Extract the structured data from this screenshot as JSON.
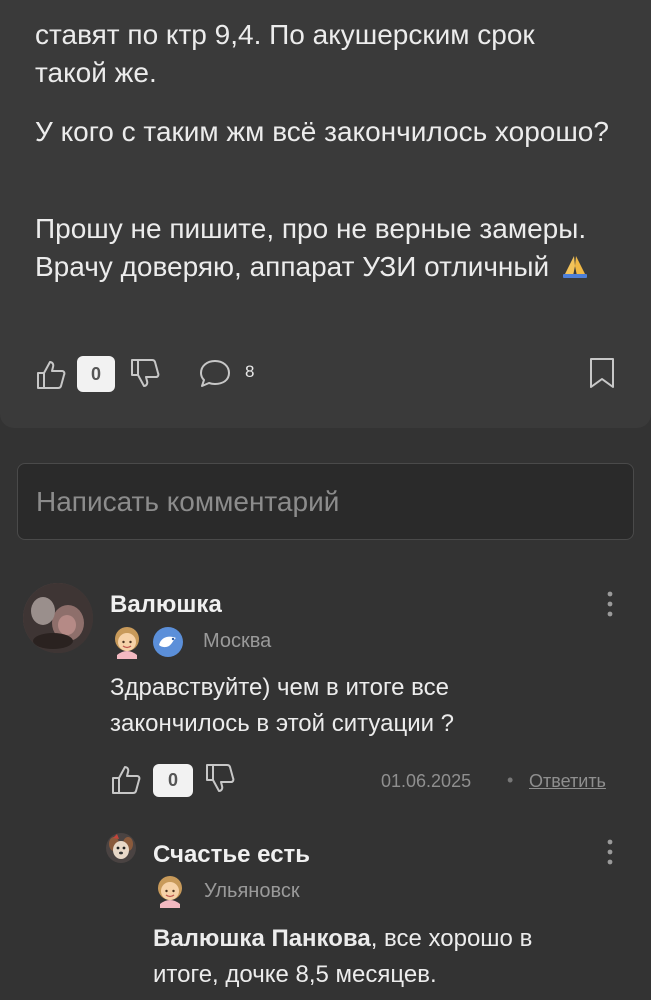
{
  "post": {
    "line_partial": "ставят по ктр 9,4. По акушерским срок",
    "line_partial_2": "такой же.",
    "paragraph_2": "У кого с таким жм всё закончилось хорошо?",
    "paragraph_3": "Прошу не пишите, про не верные замеры. Врачу доверяю, аппарат УЗИ отличный",
    "like_count": "0",
    "comments_count": "8"
  },
  "comment_input": {
    "placeholder": "Написать комментарий"
  },
  "comments": [
    {
      "author": "Валюшка",
      "city": "Москва",
      "text": "Здравствуйте) чем в итоге все закончилось в этой ситуации ?",
      "likes": "0",
      "date": "01.06.2025",
      "reply_label": "Ответить",
      "replies": [
        {
          "author": "Счастье есть",
          "city": "Ульяновск",
          "mention": "Валюшка Панкова",
          "text": ", все хорошо в итоге, дочке 8,5 месяцев."
        }
      ]
    }
  ],
  "colors": {
    "background": "#333333",
    "card": "#3a3a3a",
    "input_bg": "#2a2a2a",
    "text_primary": "#ececec",
    "text_secondary": "#9a9a9a",
    "count_box": "#f2f2f2"
  },
  "icons": [
    "thumbs-up-icon",
    "thumbs-down-icon",
    "comment-bubble-icon",
    "bookmark-icon",
    "praying-hands-icon",
    "more-vertical-icon",
    "girl-emoji-icon",
    "bird-badge-icon",
    "dog-avatar-icon"
  ]
}
